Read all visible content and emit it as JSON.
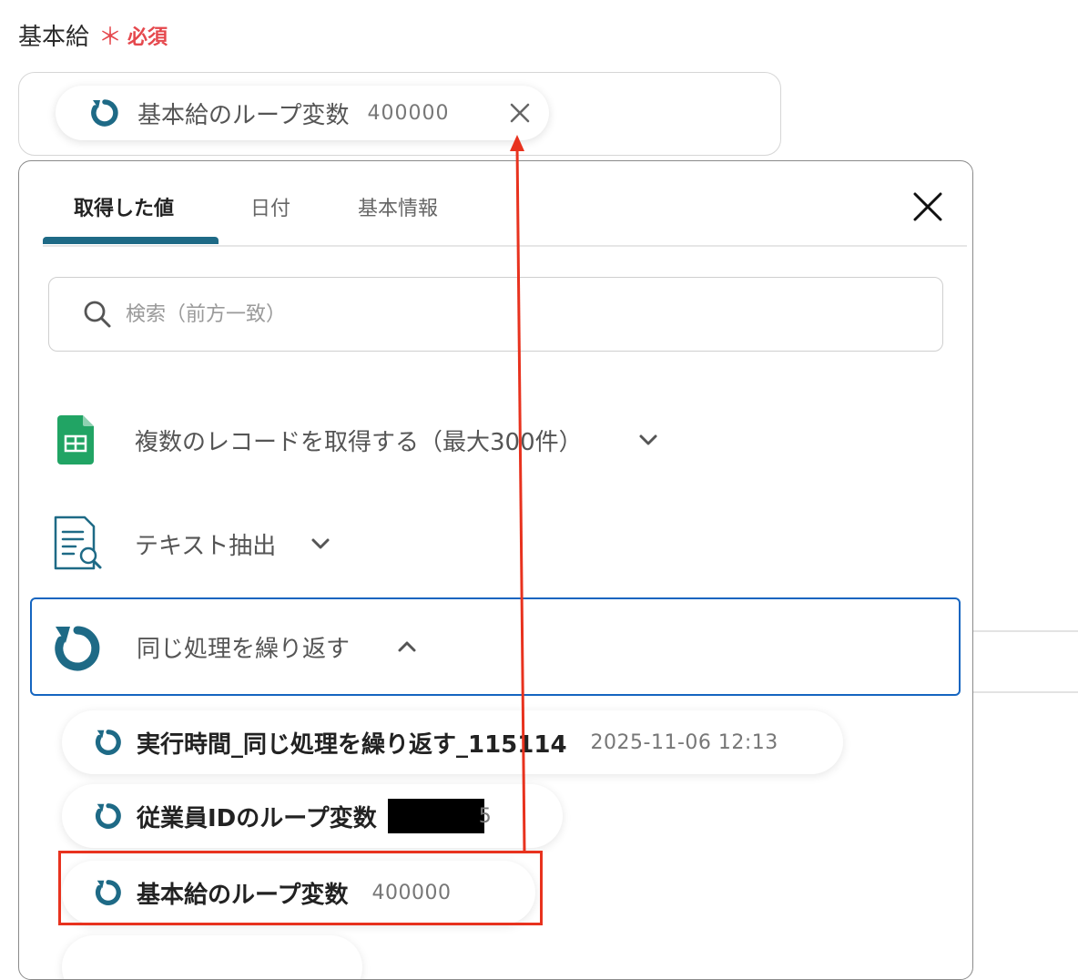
{
  "field": {
    "label": "基本給",
    "required_mark": "＊",
    "required_text": "必須"
  },
  "selected_chip": {
    "label": "基本給のループ変数",
    "value": "400000",
    "icon": "loop-icon"
  },
  "panel": {
    "tabs": [
      {
        "label": "取得した値",
        "active": true
      },
      {
        "label": "日付",
        "active": false
      },
      {
        "label": "基本情報",
        "active": false
      }
    ],
    "search": {
      "placeholder": "検索（前方一致）"
    },
    "groups": [
      {
        "label": "複数のレコードを取得する（最大300件）",
        "icon": "google-sheets-icon",
        "expanded": false
      },
      {
        "label": "テキスト抽出",
        "icon": "document-search-icon",
        "expanded": false
      },
      {
        "label": "同じ処理を繰り返す",
        "icon": "loop-icon",
        "expanded": true
      }
    ],
    "items": [
      {
        "label": "実行時間_同じ処理を繰り返す_115114",
        "value": "2025-11-06 12:13"
      },
      {
        "label": "従業員IDのループ変数",
        "value_tail": "5"
      },
      {
        "label": "基本給のループ変数",
        "value": "400000"
      }
    ]
  },
  "colors": {
    "accent": "#1e6a86",
    "required": "#e5484d",
    "annotation": "#e8321e",
    "expanded_border": "#1565c0"
  }
}
